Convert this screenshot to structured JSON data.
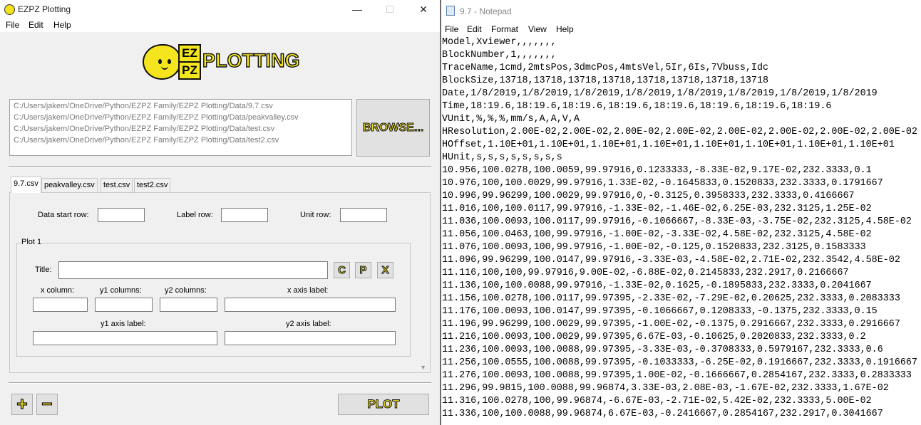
{
  "ezpz": {
    "title": "EZPZ Plotting",
    "controls": {
      "minimize": "—",
      "maximize": "☐",
      "close": "✕"
    },
    "menu": [
      "File",
      "Edit",
      "Help"
    ],
    "logo": {
      "ez": "EZ",
      "pz": "PZ",
      "word": "PLOTTING"
    },
    "files": [
      "C:/Users/jakem/OneDrive/Python/EZPZ Family/EZPZ Plotting/Data/9.7.csv",
      "C:/Users/jakem/OneDrive/Python/EZPZ Family/EZPZ Plotting/Data/peakvalley.csv",
      "C:/Users/jakem/OneDrive/Python/EZPZ Family/EZPZ Plotting/Data/test.csv",
      "C:/Users/jakem/OneDrive/Python/EZPZ Family/EZPZ Plotting/Data/test2.csv"
    ],
    "browse_label": "BROWSE...",
    "tabs": [
      "9.7.csv",
      "peakvalley.csv",
      "test.csv",
      "test2.csv"
    ],
    "active_tab": "9.7.csv",
    "row_labels": {
      "data_start": "Data start row:",
      "label": "Label row:",
      "unit": "Unit row:"
    },
    "row_values": {
      "data_start": "",
      "label": "",
      "unit": ""
    },
    "plot": {
      "frame_title": "Plot 1",
      "title_label": "Title:",
      "title_value": "",
      "buttons": {
        "c": "C",
        "p": "P",
        "x": "X"
      },
      "x_column": "x column:",
      "y1_columns": "y1 columns:",
      "y2_columns": "y2 columns:",
      "x_axis_label": "x axis label:",
      "y1_axis_label": "y1 axis label:",
      "y2_axis_label": "y2 axis label:"
    },
    "add_label": "+",
    "remove_label": "−",
    "plot_label": "PLOT",
    "accent_color": "#f4e51e"
  },
  "notepad": {
    "title": "9.7 - Notepad",
    "menu": [
      "File",
      "Edit",
      "Format",
      "View",
      "Help"
    ],
    "lines": [
      "Model,Xviewer,,,,,,,",
      "BlockNumber,1,,,,,,,",
      "TraceName,1cmd,2mtsPos,3dmcPos,4mtsVel,5Ir,6Is,7Vbuss,Idc",
      "BlockSize,13718,13718,13718,13718,13718,13718,13718,13718",
      "Date,1/8/2019,1/8/2019,1/8/2019,1/8/2019,1/8/2019,1/8/2019,1/8/2019,1/8/2019",
      "Time,18:19.6,18:19.6,18:19.6,18:19.6,18:19.6,18:19.6,18:19.6,18:19.6",
      "VUnit,%,%,%,mm/s,A,A,V,A",
      "HResolution,2.00E-02,2.00E-02,2.00E-02,2.00E-02,2.00E-02,2.00E-02,2.00E-02,2.00E-02",
      "HOffset,1.10E+01,1.10E+01,1.10E+01,1.10E+01,1.10E+01,1.10E+01,1.10E+01,1.10E+01",
      "HUnit,s,s,s,s,s,s,s,s",
      "10.956,100.0278,100.0059,99.97916,0.1233333,-8.33E-02,9.17E-02,232.3333,0.1",
      "10.976,100,100.0029,99.97916,1.33E-02,-0.1645833,0.1520833,232.3333,0.1791667",
      "10.996,99.96299,100.0029,99.97916,0,-0.3125,0.3958333,232.3333,0.4166667",
      "11.016,100,100.0117,99.97916,-1.33E-02,-1.46E-02,6.25E-03,232.3125,1.25E-02",
      "11.036,100.0093,100.0117,99.97916,-0.1066667,-8.33E-03,-3.75E-02,232.3125,4.58E-02",
      "11.056,100.0463,100,99.97916,-1.00E-02,-3.33E-02,4.58E-02,232.3125,4.58E-02",
      "11.076,100.0093,100,99.97916,-1.00E-02,-0.125,0.1520833,232.3125,0.1583333",
      "11.096,99.96299,100.0147,99.97916,-3.33E-03,-4.58E-02,2.71E-02,232.3542,4.58E-02",
      "11.116,100,100,99.97916,9.00E-02,-6.88E-02,0.2145833,232.2917,0.2166667",
      "11.136,100,100.0088,99.97916,-1.33E-02,0.1625,-0.1895833,232.3333,0.2041667",
      "11.156,100.0278,100.0117,99.97395,-2.33E-02,-7.29E-02,0.20625,232.3333,0.2083333",
      "11.176,100.0093,100.0147,99.97395,-0.1066667,0.1208333,-0.1375,232.3333,0.15",
      "11.196,99.96299,100.0029,99.97395,-1.00E-02,-0.1375,0.2916667,232.3333,0.2916667",
      "11.216,100.0093,100.0029,99.97395,6.67E-03,-0.10625,0.2020833,232.3333,0.2",
      "11.236,100.0093,100.0088,99.97395,-3.33E-03,-0.3708333,0.5979167,232.3333,0.6",
      "11.256,100.0555,100.0088,99.97395,-0.1033333,-6.25E-02,0.1916667,232.3333,0.1916667",
      "11.276,100.0093,100.0088,99.97395,1.00E-02,-0.1666667,0.2854167,232.3333,0.2833333",
      "11.296,99.9815,100.0088,99.96874,3.33E-03,2.08E-03,-1.67E-02,232.3333,1.67E-02",
      "11.316,100.0278,100,99.96874,-6.67E-03,-2.71E-02,5.42E-02,232.3333,5.00E-02",
      "11.336,100,100.0088,99.96874,6.67E-03,-0.2416667,0.2854167,232.2917,0.3041667"
    ]
  }
}
